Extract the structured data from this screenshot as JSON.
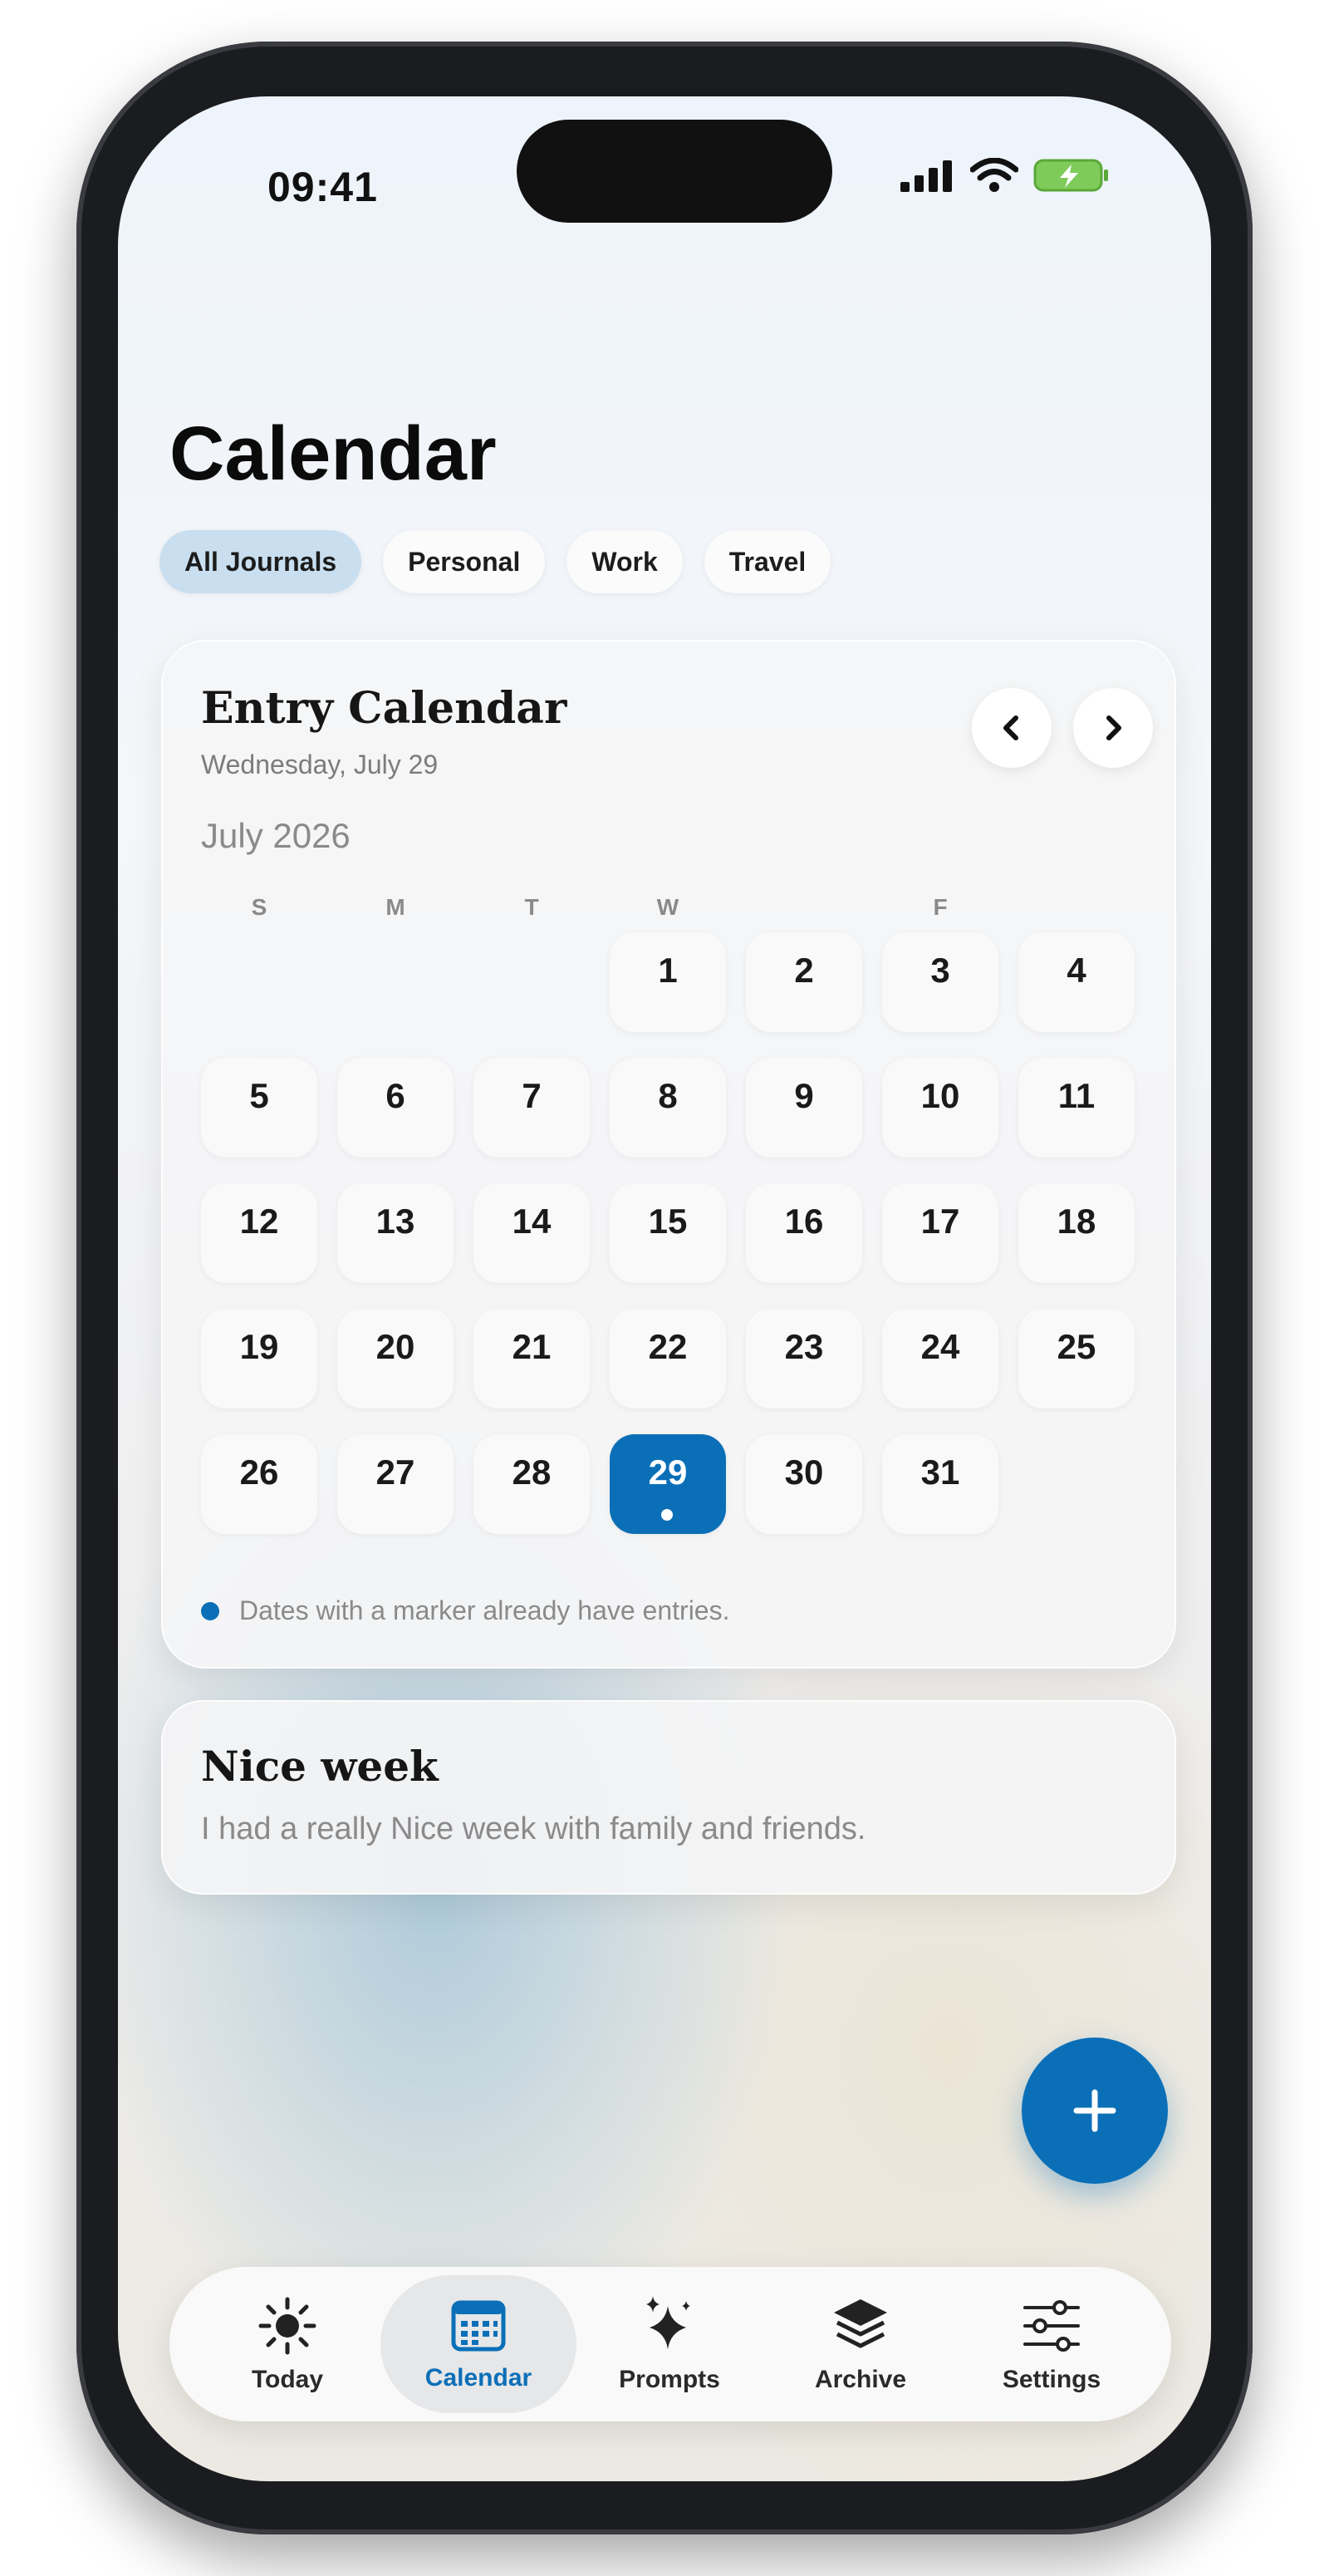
{
  "status_bar": {
    "time": "09:41"
  },
  "page": {
    "title": "Calendar"
  },
  "filters": [
    "All Journals",
    "Personal",
    "Work",
    "Travel"
  ],
  "active_filter": "All Journals",
  "calendar_card": {
    "title": "Entry Calendar",
    "subtitle": "Wednesday, July 29",
    "month_label": "July 2026",
    "weekday_headers": [
      "S",
      "M",
      "T",
      "W",
      "",
      "F",
      ""
    ],
    "days": [
      "1",
      "2",
      "3",
      "4",
      "5",
      "6",
      "7",
      "8",
      "9",
      "10",
      "11",
      "12",
      "13",
      "14",
      "15",
      "16",
      "17",
      "18",
      "19",
      "20",
      "21",
      "22",
      "23",
      "24",
      "25",
      "26",
      "27",
      "28",
      "29",
      "30",
      "31"
    ],
    "first_day_column": 3,
    "selected_day": "29",
    "days_with_entries": [
      "29"
    ],
    "legend_text": "Dates with a marker already have entries."
  },
  "entry": {
    "title": "Nice week",
    "body": "I had a really Nice week with family and friends."
  },
  "fab": {
    "icon": "plus-icon"
  },
  "tab_bar": {
    "tabs": [
      {
        "label": "Today",
        "icon": "sun-icon"
      },
      {
        "label": "Calendar",
        "icon": "calendar-icon"
      },
      {
        "label": "Prompts",
        "icon": "sparkles-icon"
      },
      {
        "label": "Archive",
        "icon": "layers-icon"
      },
      {
        "label": "Settings",
        "icon": "sliders-icon"
      }
    ],
    "active": "Calendar"
  },
  "colors": {
    "accent": "#0b6fb8",
    "active_chip": "#c9dff0"
  }
}
